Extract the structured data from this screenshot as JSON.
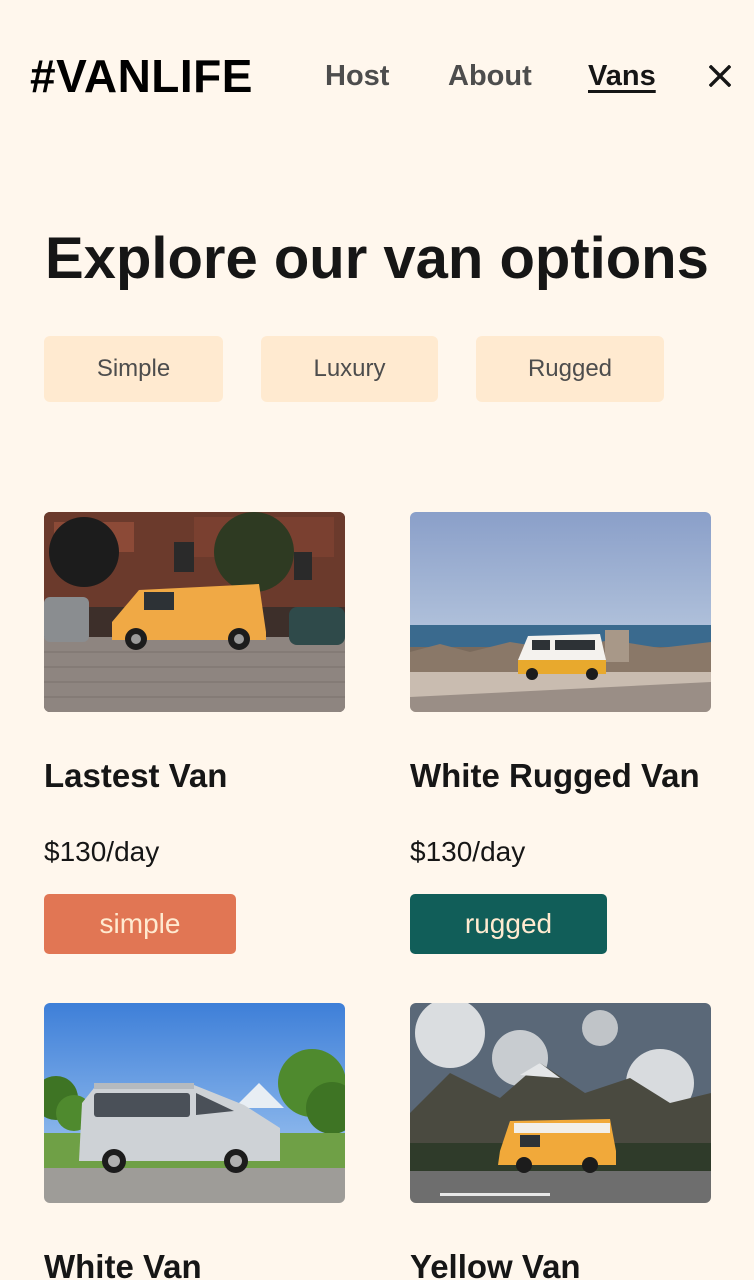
{
  "header": {
    "logo": "#VANLIFE",
    "nav": {
      "host": "Host",
      "about": "About",
      "vans": "Vans"
    },
    "close_icon": "close-icon"
  },
  "main": {
    "title": "Explore our van options",
    "filters": [
      "Simple",
      "Luxury",
      "Rugged"
    ],
    "vans": [
      {
        "name": "Lastest Van",
        "price": "$130/day",
        "type": "simple",
        "image": "orange-van-on-cobblestone-street"
      },
      {
        "name": "White Rugged Van",
        "price": "$130/day",
        "type": "rugged",
        "image": "white-yellow-van-by-sea"
      },
      {
        "name": "White Van",
        "image": "silver-sprinter-van-in-orchard"
      },
      {
        "name": "Yellow Van",
        "image": "yellow-vw-bus-in-mountains"
      }
    ]
  },
  "colors": {
    "background": "#FFF7ED",
    "filter_bg": "#FFEAD0",
    "simple": "#E17654",
    "rugged": "#115E59"
  }
}
